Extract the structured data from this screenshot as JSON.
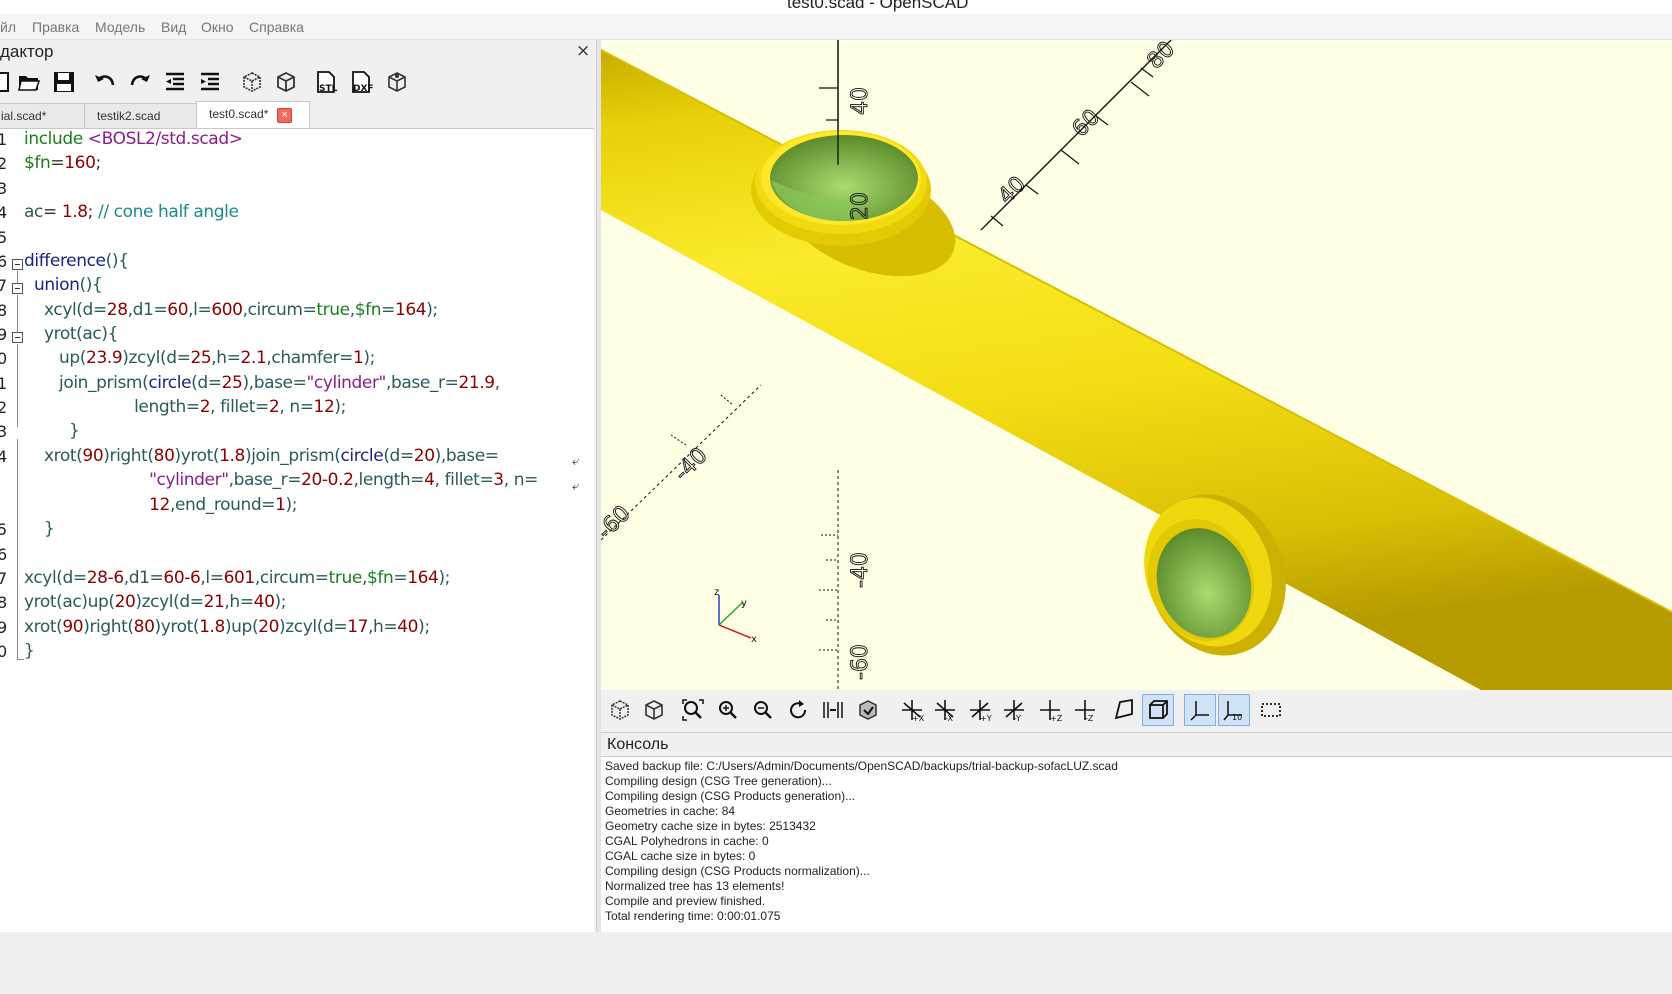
{
  "window": {
    "title": "test0.scad - OpenSCAD"
  },
  "menu": [
    "йл",
    "Правка",
    "Модель",
    "Вид",
    "Окно",
    "Справка"
  ],
  "editor": {
    "title": "дактор",
    "close": "×",
    "toolbar": [
      {
        "icon": "new-file-icon"
      },
      {
        "icon": "open-file-icon"
      },
      {
        "icon": "save-icon"
      },
      {
        "icon": "undo-icon"
      },
      {
        "icon": "redo-icon"
      },
      {
        "icon": "unindent-icon"
      },
      {
        "icon": "indent-icon"
      },
      {
        "icon": "preview-icon"
      },
      {
        "icon": "render-icon"
      },
      {
        "icon": "export-stl-icon",
        "label": "STL"
      },
      {
        "icon": "export-dxf-icon",
        "label": "DXF"
      },
      {
        "icon": "send-to-print-icon"
      }
    ],
    "tabs": [
      {
        "label": "ial.scad*"
      },
      {
        "label": "testik2.scad"
      },
      {
        "label": "test0.scad*",
        "active": true,
        "close": "×"
      }
    ],
    "line_numbers": [
      "1",
      "2",
      "3",
      "4",
      "5",
      "6",
      "7",
      "8",
      "9",
      "0",
      "1",
      "2",
      "3",
      "4",
      "",
      "",
      "5",
      "6",
      "7",
      "8",
      "9",
      "0"
    ],
    "code": [
      [
        [
          "k-inc",
          "include "
        ],
        [
          "k-path",
          "<BOSL2/std.scad>"
        ]
      ],
      [
        [
          "k-var",
          "$fn"
        ],
        [
          "",
          "="
        ],
        [
          "k-num",
          "160"
        ],
        [
          "",
          ";"
        ]
      ],
      [],
      [
        [
          "k-fn",
          "ac"
        ],
        [
          "",
          "= "
        ],
        [
          "k-num",
          "1.8"
        ],
        [
          "",
          "; "
        ],
        [
          "k-com",
          "// cone half angle"
        ]
      ],
      [],
      [
        [
          "k-kw",
          "difference"
        ],
        [
          "k-fn",
          "(){"
        ]
      ],
      [
        [
          "",
          "  "
        ],
        [
          "k-kw",
          "union"
        ],
        [
          "k-fn",
          "(){"
        ]
      ],
      [
        [
          "",
          "    "
        ],
        [
          "k-fn",
          "xcyl("
        ],
        [
          "k-fn",
          "d="
        ],
        [
          "k-num",
          "28"
        ],
        [
          "k-fn",
          ",d1="
        ],
        [
          "k-num",
          "60"
        ],
        [
          "k-fn",
          ",l="
        ],
        [
          "k-num",
          "600"
        ],
        [
          "k-fn",
          ",circum="
        ],
        [
          "k-var",
          "true"
        ],
        [
          "k-fn",
          ","
        ],
        [
          "k-var",
          "$fn"
        ],
        [
          "k-fn",
          "="
        ],
        [
          "k-num",
          "164"
        ],
        [
          "k-fn",
          ");"
        ]
      ],
      [
        [
          "",
          "    "
        ],
        [
          "k-fn",
          "yrot(ac){"
        ]
      ],
      [
        [
          "",
          "       "
        ],
        [
          "k-fn",
          "up("
        ],
        [
          "k-num",
          "23.9"
        ],
        [
          "k-fn",
          ")zcyl(d="
        ],
        [
          "k-num",
          "25"
        ],
        [
          "k-fn",
          ",h="
        ],
        [
          "k-num",
          "2.1"
        ],
        [
          "k-fn",
          ",chamfer="
        ],
        [
          "k-num",
          "1"
        ],
        [
          "k-fn",
          ");"
        ]
      ],
      [
        [
          "",
          "       "
        ],
        [
          "k-fn",
          "join_prism("
        ],
        [
          "k-kw",
          "circle"
        ],
        [
          "k-fn",
          "(d="
        ],
        [
          "k-num",
          "25"
        ],
        [
          "k-fn",
          "),base="
        ],
        [
          "k-str",
          "\"cylinder\""
        ],
        [
          "k-fn",
          ",base_r="
        ],
        [
          "k-num",
          "21.9"
        ],
        [
          "k-fn",
          ","
        ]
      ],
      [
        [
          "",
          "                      "
        ],
        [
          "k-fn",
          "length="
        ],
        [
          "k-num",
          "2"
        ],
        [
          "k-fn",
          ", fillet="
        ],
        [
          "k-num",
          "2"
        ],
        [
          "k-fn",
          ", n="
        ],
        [
          "k-num",
          "12"
        ],
        [
          "k-fn",
          ");"
        ]
      ],
      [
        [
          "",
          "         "
        ],
        [
          "k-fn",
          "}"
        ]
      ],
      [
        [
          "",
          "    "
        ],
        [
          "k-fn",
          "xrot("
        ],
        [
          "k-num",
          "90"
        ],
        [
          "k-fn",
          ")right("
        ],
        [
          "k-num",
          "80"
        ],
        [
          "k-fn",
          ")yrot("
        ],
        [
          "k-num",
          "1.8"
        ],
        [
          "k-fn",
          ")join_prism("
        ],
        [
          "k-kw",
          "circle"
        ],
        [
          "k-fn",
          "(d="
        ],
        [
          "k-num",
          "20"
        ],
        [
          "k-fn",
          "),base="
        ]
      ],
      [
        [
          "",
          "                         "
        ],
        [
          "k-str",
          "\"cylinder\""
        ],
        [
          "k-fn",
          ",base_r="
        ],
        [
          "k-num",
          "20-0.2"
        ],
        [
          "k-fn",
          ",length="
        ],
        [
          "k-num",
          "4"
        ],
        [
          "k-fn",
          ", fillet="
        ],
        [
          "k-num",
          "3"
        ],
        [
          "k-fn",
          ", n="
        ]
      ],
      [
        [
          "",
          "                         "
        ],
        [
          "k-num",
          "12"
        ],
        [
          "k-fn",
          ",end_round="
        ],
        [
          "k-num",
          "1"
        ],
        [
          "k-fn",
          ");"
        ]
      ],
      [
        [
          "",
          "    "
        ],
        [
          "k-fn",
          "}"
        ]
      ],
      [],
      [
        [
          "k-fn",
          "xcyl(d="
        ],
        [
          "k-num",
          "28-6"
        ],
        [
          "k-fn",
          ",d1="
        ],
        [
          "k-num",
          "60-6"
        ],
        [
          "k-fn",
          ",l="
        ],
        [
          "k-num",
          "601"
        ],
        [
          "k-fn",
          ",circum="
        ],
        [
          "k-var",
          "true"
        ],
        [
          "k-fn",
          ","
        ],
        [
          "k-var",
          "$fn"
        ],
        [
          "k-fn",
          "="
        ],
        [
          "k-num",
          "164"
        ],
        [
          "k-fn",
          ");"
        ]
      ],
      [
        [
          "k-fn",
          "yrot(ac)up("
        ],
        [
          "k-num",
          "20"
        ],
        [
          "k-fn",
          ")zcyl(d="
        ],
        [
          "k-num",
          "21"
        ],
        [
          "k-fn",
          ",h="
        ],
        [
          "k-num",
          "40"
        ],
        [
          "k-fn",
          ");"
        ]
      ],
      [
        [
          "k-fn",
          "xrot("
        ],
        [
          "k-num",
          "90"
        ],
        [
          "k-fn",
          ")right("
        ],
        [
          "k-num",
          "80"
        ],
        [
          "k-fn",
          ")yrot("
        ],
        [
          "k-num",
          "1.8"
        ],
        [
          "k-fn",
          ")up("
        ],
        [
          "k-num",
          "20"
        ],
        [
          "k-fn",
          ")zcyl(d="
        ],
        [
          "k-num",
          "17"
        ],
        [
          "k-fn",
          ",h="
        ],
        [
          "k-num",
          "40"
        ],
        [
          "k-fn",
          ");"
        ]
      ],
      [
        [
          "k-fn",
          "}"
        ]
      ]
    ],
    "wrap_marks": [
      "⤶",
      "⤶"
    ]
  },
  "viewport": {
    "axis_labels": {
      "z_top": "40",
      "z_mid": "20",
      "y_ticks": [
        "40",
        "60",
        "80"
      ],
      "x_neg": [
        "-40",
        "-60"
      ],
      "z_neg": [
        "-40",
        "-60"
      ]
    },
    "mini_axes": {
      "x": "x",
      "y": "y",
      "z": "z"
    },
    "colors": {
      "background": "#ffffe5",
      "model": "#f5e21a",
      "model_shadow": "#c8b000",
      "hole": "#8fcc5a"
    }
  },
  "viewbar": [
    {
      "icon": "preview-icon"
    },
    {
      "icon": "render-icon"
    },
    {
      "icon": "view-all-icon"
    },
    {
      "icon": "zoom-in-icon"
    },
    {
      "icon": "zoom-out-icon"
    },
    {
      "icon": "reset-view-icon"
    },
    {
      "icon": "view-center-icon"
    },
    {
      "icon": "view-diagonal-icon"
    },
    {
      "icon": "view-right-icon",
      "sub": "+X"
    },
    {
      "icon": "view-left-icon",
      "sub": "-X"
    },
    {
      "icon": "view-back-icon",
      "sub": "+Y"
    },
    {
      "icon": "view-front-icon",
      "sub": "-Y"
    },
    {
      "icon": "view-top-icon",
      "sub": "+Z"
    },
    {
      "icon": "view-bottom-icon",
      "sub": "-Z"
    },
    {
      "icon": "perspective-icon"
    },
    {
      "icon": "orthogonal-icon",
      "active": true
    },
    {
      "icon": "show-axes-icon",
      "active": true
    },
    {
      "icon": "show-scale-icon",
      "active": true,
      "sub": "10"
    },
    {
      "icon": "show-edges-icon"
    }
  ],
  "console": {
    "title": "Консоль",
    "lines": [
      "Saved backup file: C:/Users/Admin/Documents/OpenSCAD/backups/trial-backup-sofacLUZ.scad",
      "Compiling design (CSG Tree generation)...",
      "Compiling design (CSG Products generation)...",
      "Geometries in cache: 84",
      "Geometry cache size in bytes: 2513432",
      "CGAL Polyhedrons in cache: 0",
      "CGAL cache size in bytes: 0",
      "Compiling design (CSG Products normalization)...",
      "Normalized tree has 13 elements!",
      "Compile and preview finished.",
      "Total rendering time: 0:00:01.075"
    ]
  }
}
